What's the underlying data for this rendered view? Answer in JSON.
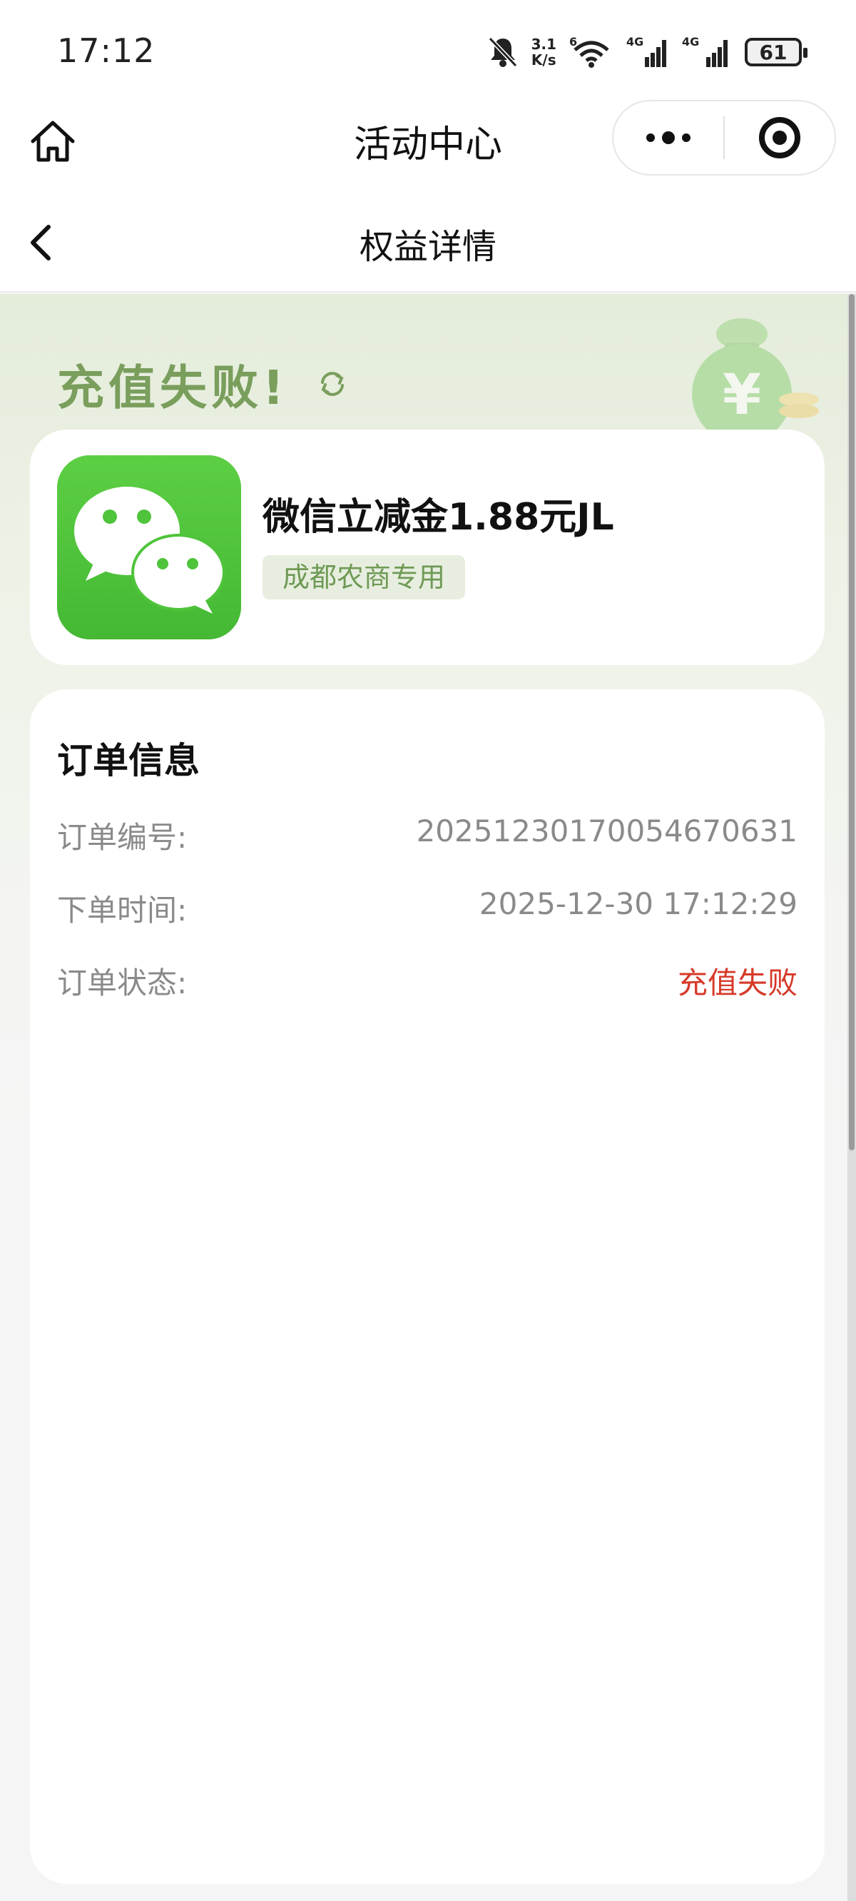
{
  "status_bar": {
    "time": "17:12",
    "net_speed_value": "3.1",
    "net_speed_unit": "K/s",
    "wifi_badge": "6",
    "signal_1_label": "4G",
    "signal_2_label": "4G",
    "battery": "61"
  },
  "nav": {
    "title": "活动中心"
  },
  "header": {
    "title": "权益详情"
  },
  "result": {
    "headline": "充值失败!"
  },
  "product": {
    "name": "微信立减金1.88元JL",
    "tag": "成都农商专用"
  },
  "order": {
    "title": "订单信息",
    "rows": [
      {
        "label": "订单编号:",
        "value": "20251230170054670631"
      },
      {
        "label": "下单时间:",
        "value": "2025-12-30 17:12:29"
      },
      {
        "label": "订单状态:",
        "value": "充值失败"
      }
    ]
  },
  "colors": {
    "accent_green": "#7a9e5c",
    "wechat_green": "#4fc43b",
    "fail_red": "#d63a2a",
    "tag_bg": "#e7eedf"
  }
}
